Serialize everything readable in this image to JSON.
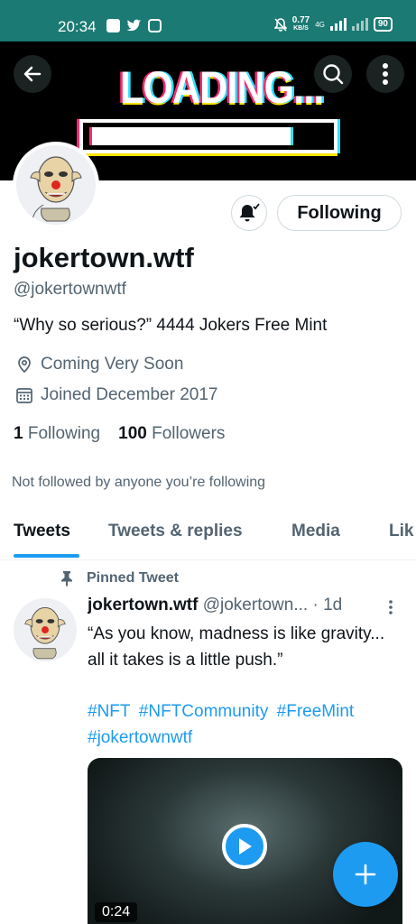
{
  "status_bar": {
    "time": "20:34",
    "speed_value": "0.77",
    "speed_unit": "KB/S",
    "network": "4G",
    "battery": "90"
  },
  "banner": {
    "text": "LOADING..."
  },
  "profile": {
    "name": "jokertown.wtf",
    "handle": "@jokertownwtf",
    "bio": "“Why so serious?” 4444 Jokers Free Mint",
    "location": "Coming Very Soon",
    "joined": "Joined December 2017",
    "following_count": "1",
    "following_label": "Following",
    "followers_count": "100",
    "followers_label": "Followers",
    "not_followed_text": "Not followed by anyone you’re following",
    "follow_button_label": "Following"
  },
  "tabs": [
    {
      "label": "Tweets",
      "active": true
    },
    {
      "label": "Tweets & replies",
      "active": false
    },
    {
      "label": "Media",
      "active": false
    },
    {
      "label": "Lik",
      "active": false
    }
  ],
  "tweet": {
    "pinned_label": "Pinned Tweet",
    "author_name": "jokertown.wtf",
    "author_handle": "@jokertown...",
    "time": "· 1d",
    "text": "“As you know, madness is like gravity... all it takes is a little push.”",
    "hashtags": [
      "#NFT",
      "#NFTCommunity",
      "#FreeMint",
      "#jokertownwtf"
    ],
    "video_duration": "0:24"
  },
  "colors": {
    "status_bar": "#1b7a73",
    "accent": "#1d9bf0",
    "secondary_text": "#536471"
  },
  "icons": {
    "back": "arrow-left-icon",
    "search": "search-icon",
    "more": "more-vertical-icon",
    "notify": "bell-check-icon",
    "location": "location-pin-icon",
    "calendar": "calendar-icon",
    "pin": "pin-icon",
    "play": "play-icon",
    "compose": "plus-icon"
  }
}
